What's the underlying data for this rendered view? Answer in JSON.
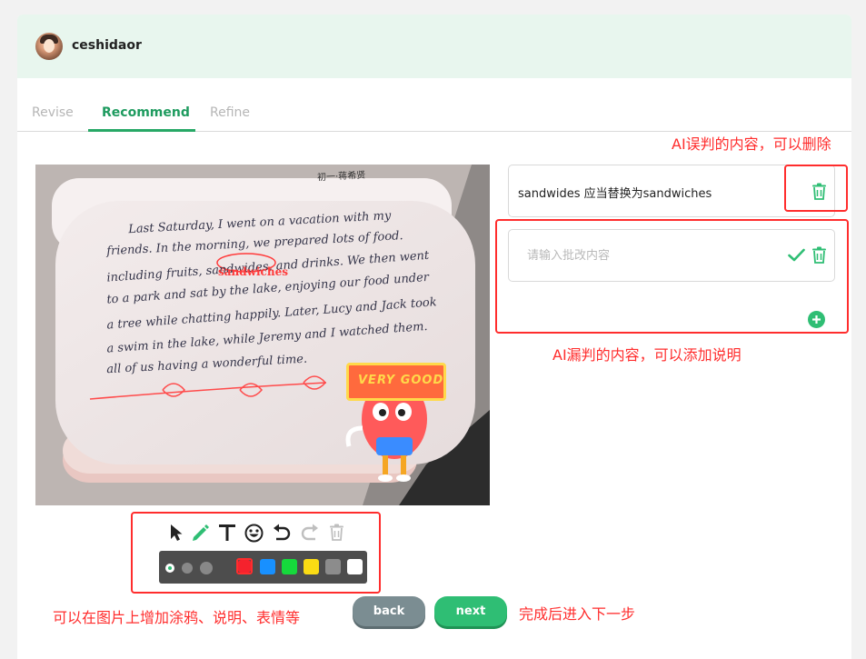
{
  "user": {
    "name": "ceshidaor"
  },
  "tabs": [
    {
      "label": "Revise"
    },
    {
      "label": "Recommend"
    },
    {
      "label": "Refine"
    }
  ],
  "photo": {
    "lines": [
      "Last Saturday, I went on a vacation with my",
      "friends. In the morning, we prepared lots of food.",
      "including fruits, sandwides, and drinks. We then went",
      "to a park and sat by the lake, enjoying our food under",
      "a tree while chatting happily. Later, Lucy and Jack took",
      "a swim in the lake, while Jeremy and I watched them.",
      "all of us having a wonderful time."
    ],
    "correction_overlay": "sandwiches",
    "top_note": "初一·蒋希贤",
    "sticker_text": "VERY GOOD"
  },
  "corrections": [
    {
      "text": "sandwides 应当替换为sandwiches",
      "delete_icon": "trash-icon"
    }
  ],
  "new_correction": {
    "placeholder": "请输入批改内容",
    "value": ""
  },
  "annotations": {
    "top_right": "AI误判的内容，可以删除",
    "middle_right": "AI漏判的内容，可以添加说明",
    "bottom_left": "可以在图片上增加涂鸦、说明、表情等",
    "bottom_right": "完成后进入下一步"
  },
  "toolbar": {
    "tools": [
      "pointer-icon",
      "pencil-icon",
      "text-icon",
      "emoji-icon",
      "undo-icon",
      "redo-icon",
      "trash-icon"
    ],
    "colors": [
      "#f5222d",
      "#1890ff",
      "#16d93c",
      "#fadb14",
      "#8c8c8c",
      "#ffffff"
    ],
    "selected_color": "#f5222d",
    "brush_sizes": [
      "small",
      "medium",
      "large"
    ],
    "selected_size": "small"
  },
  "buttons": {
    "back": "back",
    "next": "next"
  },
  "colors": {
    "accent": "#27a866",
    "annotation": "#ff2d2d",
    "header_bg": "#e8f6ee"
  }
}
